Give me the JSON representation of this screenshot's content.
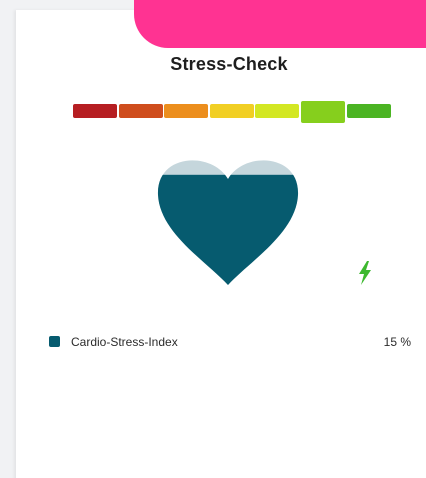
{
  "widget": {
    "title": "Stress-Check"
  },
  "stress_scale": {
    "segment_colors": [
      "#b61e22",
      "#cf4d1d",
      "#ec8e1d",
      "#f1cf24",
      "#d3e723",
      "#86cf1d",
      "#4bb423"
    ],
    "active_index": 5
  },
  "heart_gauge": {
    "fill_percent": 15,
    "fill_color": "#065b6f",
    "empty_color": "#c5d6dc"
  },
  "indicator": {
    "icon": "lightning-bolt-icon",
    "color": "#3db82f"
  },
  "legend": {
    "label": "Cardio-Stress-Index",
    "value": "15 %",
    "swatch_color": "#065b6f"
  },
  "colors": {
    "accent": "#ff3392"
  }
}
